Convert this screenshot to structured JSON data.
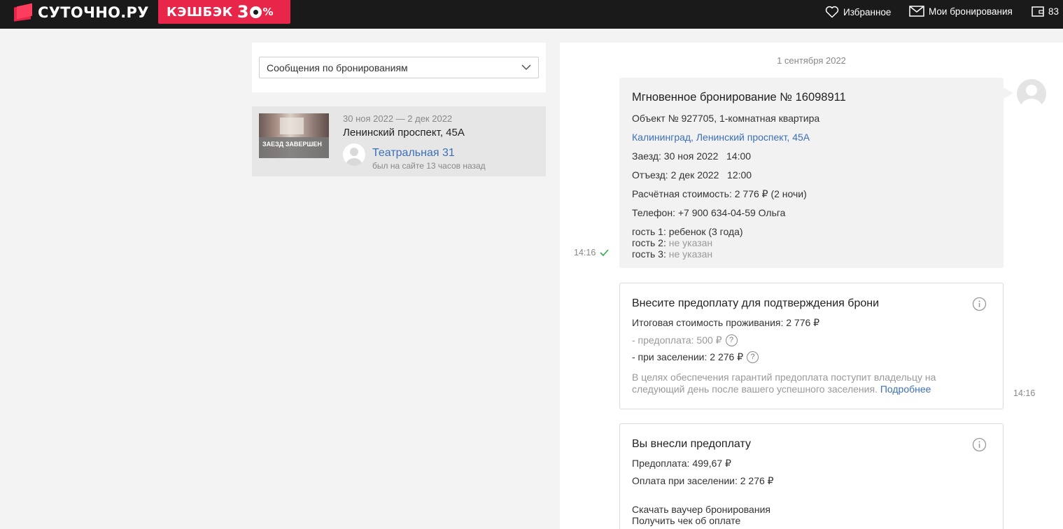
{
  "header": {
    "logo_text": "СУТОЧНО.РУ",
    "cashback_word": "КЭШБЭК",
    "cashback_digit": "3",
    "cashback_percent": "%",
    "nav": {
      "favorites": "Избранное",
      "bookings": "Мои бронирования",
      "balance": "83"
    }
  },
  "filter": {
    "selected": "Сообщения по бронированиям"
  },
  "booking": {
    "status_badge": "ЗАЕЗД ЗАВЕРШЕН",
    "dates": "30 ноя 2022 — 2 дек 2022",
    "address": "Ленинский проспект, 45А",
    "host_name": "Театральная 31",
    "host_seen": "был на сайте 13 часов назад"
  },
  "chat": {
    "date": "1 сентября 2022",
    "message": {
      "title": "Мгновенное бронирование № 16098911",
      "object": "Объект № 927705, 1-комнатная квартира",
      "location_link": "Калининград, Ленинский проспект, 45А",
      "checkin": "Заезд: 30 ноя 2022   14:00",
      "checkout": "Отъезд: 2 дек 2022   12:00",
      "price": "Расчётная стоимость: 2 776 ₽ (2 ночи)",
      "phone": "Телефон: +7 900 634-04-59 Ольга",
      "guest1_label": "гость 1:",
      "guest1_value": "ребенок (3 года)",
      "guest2_label": "гость 2:",
      "guest2_value": "не указан",
      "guest3_label": "гость 3:",
      "guest3_value": "не указан",
      "time": "14:16"
    },
    "prepay_card": {
      "title": "Внесите предоплату для подтверждения брони",
      "total": "Итоговая стоимость проживания: 2 776 ₽",
      "prepay": "- предоплата: 500 ₽",
      "on_checkin": "- при заселении: 2 276 ₽",
      "note": "В целях обеспечения гарантий предоплата поступит владельцу на следующий день после вашего успешного заселения.",
      "more_link": "Подробнее",
      "qmark": "?",
      "time": "14:16"
    },
    "paid_card": {
      "title": "Вы внесли предоплату",
      "prepay": "Предоплата: 499,67 ₽",
      "on_checkin": "Оплата при заселении: 2 276 ₽",
      "voucher_link": "Скачать ваучер бронирования",
      "receipt_link": "Получить чек об оплате"
    }
  },
  "colors": {
    "brand_red": "#e8264a",
    "link_blue": "#3b6fb6",
    "header_bg": "#1a1a1a"
  }
}
